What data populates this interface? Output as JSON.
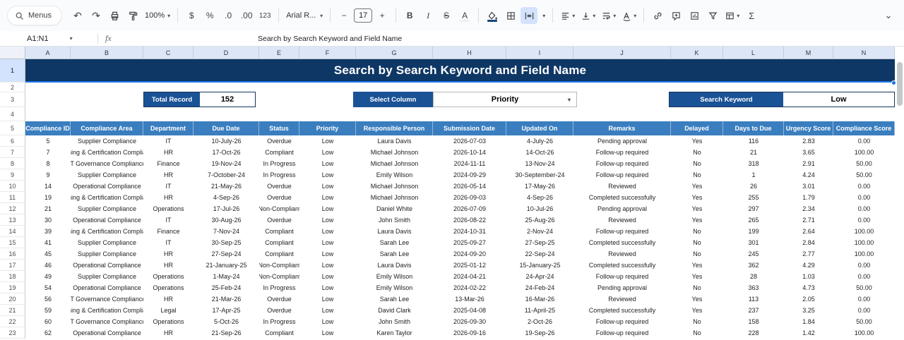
{
  "colors": {
    "banner_bg": "#0e3765",
    "table_header_bg": "#3a7ebf",
    "label_bg": "#1a5296",
    "selection": "#1a73e8",
    "toolbar_highlight": "#d3e3fd"
  },
  "icons": {
    "undo": "↶",
    "redo": "↷",
    "caret": "▾",
    "chevron_collapse": "⌄"
  },
  "toolbar": {
    "menus_label": "Menus",
    "zoom_value": "100%",
    "currency": "$",
    "percent": "%",
    "decrease_decimal": ".0",
    "increase_decimal": ".00",
    "plain_format": "123",
    "font_name": "Arial R...",
    "font_size": "17",
    "minus": "−",
    "plus": "+",
    "bold": "B",
    "italic": "I",
    "strikethrough": "S",
    "text_color": "A",
    "sum": "Σ"
  },
  "formula_bar": {
    "name_box": "A1:N1",
    "fx_label": "fx",
    "content": "Search by Search Keyword and Field Name"
  },
  "sheet": {
    "column_letters": [
      "A",
      "B",
      "C",
      "D",
      "E",
      "F",
      "G",
      "H",
      "I",
      "J",
      "K",
      "L",
      "M",
      "N"
    ],
    "row_numbers": [
      "1",
      "2",
      "3",
      "4",
      "5",
      "6",
      "7",
      "8",
      "9",
      "10",
      "11",
      "12",
      "13",
      "14",
      "15",
      "16",
      "17",
      "18",
      "19",
      "20",
      "21",
      "22",
      "23"
    ],
    "banner_title": "Search by Search Keyword and Field Name",
    "controls": {
      "total_record_label": "Total Record",
      "total_record_value": "152",
      "select_column_label": "Select Column",
      "select_column_value": "Priority",
      "search_keyword_label": "Search Keyword",
      "search_keyword_value": "Low"
    },
    "table": {
      "headers": [
        "Compliance ID",
        "Compliance Area",
        "Department",
        "Due Date",
        "Status",
        "Priority",
        "Responsible Person",
        "Submission Date",
        "Updated On",
        "Remarks",
        "Delayed",
        "Days to Due",
        "Urgency Score",
        "Compliance Score"
      ],
      "rows": [
        [
          "5",
          "Supplier Compliance",
          "IT",
          "10-July-26",
          "Overdue",
          "Low",
          "Laura Davis",
          "2026-07-03",
          "4-July-26",
          "Pending approval",
          "Yes",
          "116",
          "2.83",
          "0.00"
        ],
        [
          "7",
          "ning & Certification Complia",
          "HR",
          "17-Oct-26",
          "Compliant",
          "Low",
          "Michael Johnson",
          "2026-10-14",
          "14-Oct-26",
          "Follow-up required",
          "No",
          "21",
          "3.65",
          "100.00"
        ],
        [
          "8",
          "IT Governance Compliance",
          "Finance",
          "19-Nov-24",
          "In Progress",
          "Low",
          "Michael Johnson",
          "2024-11-11",
          "13-Nov-24",
          "Follow-up required",
          "No",
          "318",
          "2.91",
          "50.00"
        ],
        [
          "9",
          "Supplier Compliance",
          "HR",
          "7-October-24",
          "In Progress",
          "Low",
          "Emily Wilson",
          "2024-09-29",
          "30-September-24",
          "Follow-up required",
          "No",
          "1",
          "4.24",
          "50.00"
        ],
        [
          "14",
          "Operational Compliance",
          "IT",
          "21-May-26",
          "Overdue",
          "Low",
          "Michael Johnson",
          "2026-05-14",
          "17-May-26",
          "Reviewed",
          "Yes",
          "26",
          "3.01",
          "0.00"
        ],
        [
          "19",
          "ning & Certification Complia",
          "HR",
          "4-Sep-26",
          "Overdue",
          "Low",
          "Michael Johnson",
          "2026-09-03",
          "4-Sep-26",
          "Completed successfully",
          "Yes",
          "255",
          "1.79",
          "0.00"
        ],
        [
          "21",
          "Supplier Compliance",
          "Operations",
          "17-Jul-26",
          "Non-Compliant",
          "Low",
          "Daniel White",
          "2026-07-09",
          "10-Jul-26",
          "Pending approval",
          "Yes",
          "297",
          "2.34",
          "0.00"
        ],
        [
          "30",
          "Operational Compliance",
          "IT",
          "30-Aug-26",
          "Overdue",
          "Low",
          "John Smith",
          "2026-08-22",
          "25-Aug-26",
          "Reviewed",
          "Yes",
          "265",
          "2.71",
          "0.00"
        ],
        [
          "39",
          "ning & Certification Complia",
          "Finance",
          "7-Nov-24",
          "Compliant",
          "Low",
          "Laura Davis",
          "2024-10-31",
          "2-Nov-24",
          "Follow-up required",
          "No",
          "199",
          "2.64",
          "100.00"
        ],
        [
          "41",
          "Supplier Compliance",
          "IT",
          "30-Sep-25",
          "Compliant",
          "Low",
          "Sarah Lee",
          "2025-09-27",
          "27-Sep-25",
          "Completed successfully",
          "No",
          "301",
          "2.84",
          "100.00"
        ],
        [
          "45",
          "Supplier Compliance",
          "HR",
          "27-Sep-24",
          "Compliant",
          "Low",
          "Sarah Lee",
          "2024-09-20",
          "22-Sep-24",
          "Reviewed",
          "No",
          "245",
          "2.77",
          "100.00"
        ],
        [
          "46",
          "Operational Compliance",
          "HR",
          "21-January-25",
          "Non-Compliant",
          "Low",
          "Laura Davis",
          "2025-01-12",
          "15-January-25",
          "Completed successfully",
          "Yes",
          "362",
          "4.29",
          "0.00"
        ],
        [
          "49",
          "Supplier Compliance",
          "Operations",
          "1-May-24",
          "Non-Compliant",
          "Low",
          "Emily Wilson",
          "2024-04-21",
          "24-Apr-24",
          "Follow-up required",
          "Yes",
          "28",
          "1.03",
          "0.00"
        ],
        [
          "54",
          "Operational Compliance",
          "Operations",
          "25-Feb-24",
          "In Progress",
          "Low",
          "Emily Wilson",
          "2024-02-22",
          "24-Feb-24",
          "Pending approval",
          "No",
          "363",
          "4.73",
          "50.00"
        ],
        [
          "56",
          "IT Governance Compliance",
          "HR",
          "21-Mar-26",
          "Overdue",
          "Low",
          "Sarah Lee",
          "13-Mar-26",
          "16-Mar-26",
          "Reviewed",
          "Yes",
          "113",
          "2.05",
          "0.00"
        ],
        [
          "59",
          "ning & Certification Complia",
          "Legal",
          "17-Apr-25",
          "Overdue",
          "Low",
          "David Clark",
          "2025-04-08",
          "11-April-25",
          "Completed successfully",
          "Yes",
          "237",
          "3.25",
          "0.00"
        ],
        [
          "60",
          "IT Governance Compliance",
          "Operations",
          "5-Oct-26",
          "In Progress",
          "Low",
          "John Smith",
          "2026-09-30",
          "2-Oct-26",
          "Follow-up required",
          "No",
          "158",
          "1.84",
          "50.00"
        ],
        [
          "62",
          "Operational Compliance",
          "HR",
          "21-Sep-26",
          "Compliant",
          "Low",
          "Karen Taylor",
          "2026-09-16",
          "19-Sep-26",
          "Follow-up required",
          "No",
          "228",
          "1.42",
          "100.00"
        ]
      ]
    }
  }
}
